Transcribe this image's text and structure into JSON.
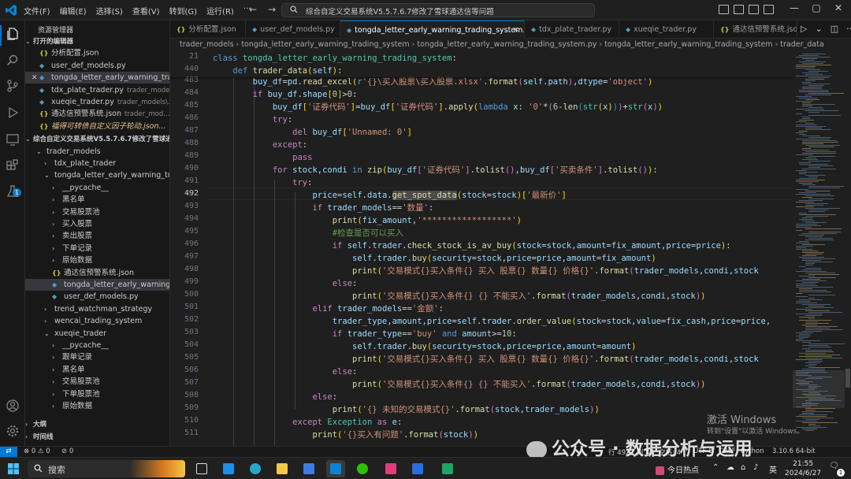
{
  "titlebar": {
    "menu": [
      "文件(F)",
      "编辑(E)",
      "选择(S)",
      "查看(V)",
      "转到(G)",
      "运行(R)",
      "···"
    ],
    "search_text": "综合自定义交易系统V5.5.7.6.7修改了雪球通达信等问题"
  },
  "sidebar": {
    "title": "资源管理器",
    "open_editors_header": "打开的编辑器",
    "open_editors": [
      {
        "icon": "{}",
        "name": "分析配置.json",
        "desc": "",
        "type": "json",
        "close": false
      },
      {
        "icon": "py",
        "name": "user_def_models.py",
        "desc": "",
        "type": "py",
        "close": false
      },
      {
        "icon": "py",
        "name": "tongda_letter_early_warning_tra...",
        "desc": "",
        "type": "py",
        "close": true
      },
      {
        "icon": "py",
        "name": "tdx_plate_trader.py",
        "desc": "trader_model...",
        "type": "py",
        "close": false
      },
      {
        "icon": "py",
        "name": "xueqie_trader.py",
        "desc": "trader_models\\...",
        "type": "py",
        "close": false
      },
      {
        "icon": "{}",
        "name": "通达信预警系统.json",
        "desc": "trader_mod...",
        "type": "json",
        "close": false
      },
      {
        "icon": "{}",
        "name": "福得可转债自定义因子轮动.json...",
        "desc": "",
        "type": "json",
        "close": false
      }
    ],
    "workspace_header": "综合自定义交易系统V5.5.7.6.7修改了雪球通达...",
    "tree": [
      {
        "label": "trader_models",
        "level": 1,
        "kind": "folder-open"
      },
      {
        "label": "tdx_plate_trader",
        "level": 2,
        "kind": "folder"
      },
      {
        "label": "tongda_letter_early_warning_tradin...",
        "level": 2,
        "kind": "folder-open"
      },
      {
        "label": "__pycache__",
        "level": 3,
        "kind": "folder"
      },
      {
        "label": "黑名单",
        "level": 3,
        "kind": "folder"
      },
      {
        "label": "交易股票池",
        "level": 3,
        "kind": "folder"
      },
      {
        "label": "买入股票",
        "level": 3,
        "kind": "folder"
      },
      {
        "label": "卖出股票",
        "level": 3,
        "kind": "folder"
      },
      {
        "label": "下单记录",
        "level": 3,
        "kind": "folder"
      },
      {
        "label": "原始数据",
        "level": 3,
        "kind": "folder"
      },
      {
        "label": "通达信预警系统.json",
        "level": 3,
        "kind": "json"
      },
      {
        "label": "tongda_letter_early_warning_tradi...",
        "level": 3,
        "kind": "py"
      },
      {
        "label": "user_def_models.py",
        "level": 3,
        "kind": "py"
      },
      {
        "label": "trend_watchman_strategy",
        "level": 2,
        "kind": "folder"
      },
      {
        "label": "wencai_trading_system",
        "level": 2,
        "kind": "folder"
      },
      {
        "label": "xueqie_trader",
        "level": 2,
        "kind": "folder-open"
      },
      {
        "label": "__pycache__",
        "level": 3,
        "kind": "folder"
      },
      {
        "label": "跟单记录",
        "level": 3,
        "kind": "folder"
      },
      {
        "label": "黑名单",
        "level": 3,
        "kind": "folder"
      },
      {
        "label": "交易股票池",
        "level": 3,
        "kind": "folder"
      },
      {
        "label": "下单股票池",
        "level": 3,
        "kind": "folder"
      },
      {
        "label": "原始数据",
        "level": 3,
        "kind": "folder"
      }
    ],
    "outline_header": "大纲",
    "timeline_header": "时间线"
  },
  "tabs": [
    {
      "label": "分析配置.json",
      "icon": "{}",
      "type": "json",
      "active": false
    },
    {
      "label": "user_def_models.py",
      "icon": "py",
      "type": "py",
      "active": false
    },
    {
      "label": "tongda_letter_early_warning_trading_system.py",
      "icon": "py",
      "type": "py",
      "active": true
    },
    {
      "label": "tdx_plate_trader.py",
      "icon": "py",
      "type": "py",
      "active": false
    },
    {
      "label": "xueqie_trader.py",
      "icon": "py",
      "type": "py",
      "active": false
    },
    {
      "label": "通达信预警系统.json",
      "icon": "{}",
      "type": "json",
      "active": false
    }
  ],
  "breadcrumb": [
    "trader_models",
    "tongda_letter_early_warning_trading_system",
    "tongda_letter_early_warning_trading_system.py",
    "tongda_letter_early_warning_trading_system",
    "trader_data"
  ],
  "editor": {
    "sticky_line_numbers": [
      "21",
      "440"
    ],
    "line_numbers": [
      "483",
      "484",
      "485",
      "486",
      "487",
      "488",
      "489",
      "490",
      "491",
      "492",
      "493",
      "494",
      "495",
      "496",
      "497",
      "498",
      "499",
      "500",
      "501",
      "502",
      "503",
      "504",
      "505",
      "506",
      "507",
      "508",
      "509",
      "510",
      "511"
    ],
    "current_line": "492"
  },
  "statusbar": {
    "errors": "0",
    "warnings": "0",
    "ports": "0",
    "position": "行 492，列 47",
    "spaces": "空格: 4",
    "encoding": "UTF-8",
    "eol": "CRLF",
    "language": "Python",
    "interpreter": "3.10.6 64-bit"
  },
  "watermarks": {
    "activate_title": "激活 Windows",
    "activate_sub": "转到\"设置\"以激活 Windows。",
    "account": "公众号 · 数据分析与运用"
  },
  "taskbar": {
    "search_placeholder": "搜索",
    "hot_topic": "今日热点",
    "ime": "英",
    "time": "21:55",
    "date": "2024/6/27",
    "notification_count": "1"
  },
  "colors": {
    "accent": "#0078d4",
    "editor_bg": "#1f1f1f",
    "sidebar_bg": "#181818"
  }
}
